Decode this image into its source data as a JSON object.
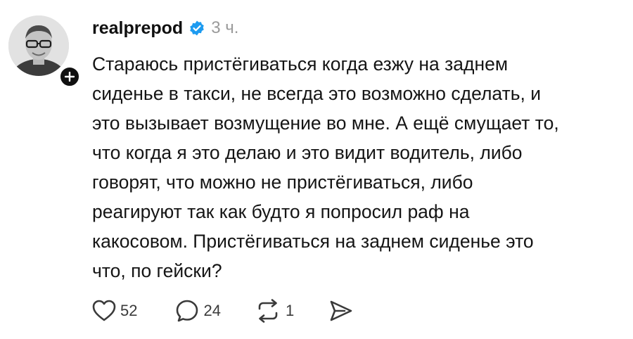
{
  "post": {
    "username": "realprepod",
    "verified": true,
    "timestamp": "3 ч.",
    "avatar_icon": "person-avatar-icon",
    "follow_icon": "plus-icon",
    "text_lines": [
      "Стараюсь пристёгиваться когда езжу на заднем",
      "сиденье в такси, не всегда это возможно сделать, и",
      "это вызывает возмущение во мне. А ещё смущает то,",
      "что когда я это делаю и это видит водитель, либо",
      "говорят, что можно не пристёгиваться, либо",
      "реагируют так как будто я попросил раф на",
      "какосовом.  Пристёгиваться на заднем сиденье это",
      "что, по гейски?"
    ]
  },
  "actions": {
    "likes": "52",
    "replies": "24",
    "reposts": "1",
    "icons": [
      "heart-icon",
      "comment-icon",
      "repost-icon",
      "share-icon"
    ]
  },
  "colors": {
    "text": "#101010",
    "muted": "#9a9a9a",
    "verified_blue": "#1d9bf0",
    "icon": "#3a3a3a"
  }
}
